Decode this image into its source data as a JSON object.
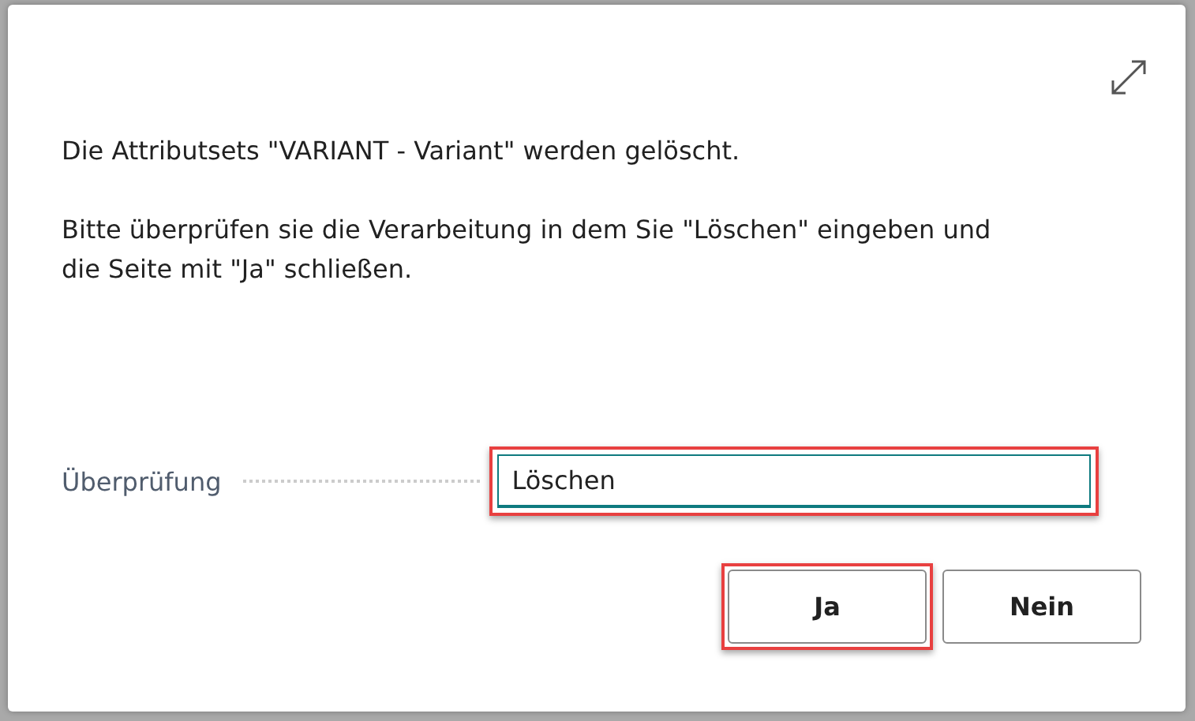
{
  "dialog": {
    "message": "Die Attributsets \"VARIANT - Variant\" werden gelöscht.",
    "instruction": "Bitte überprüfen sie die Verarbeitung in dem Sie \"Löschen\" eingeben und die Seite mit \"Ja\" schließen.",
    "field": {
      "label": "Überprüfung",
      "value": "Löschen",
      "highlighted": true
    },
    "buttons": [
      {
        "label": "Ja",
        "highlighted": true
      },
      {
        "label": "Nein",
        "highlighted": false
      }
    ]
  }
}
